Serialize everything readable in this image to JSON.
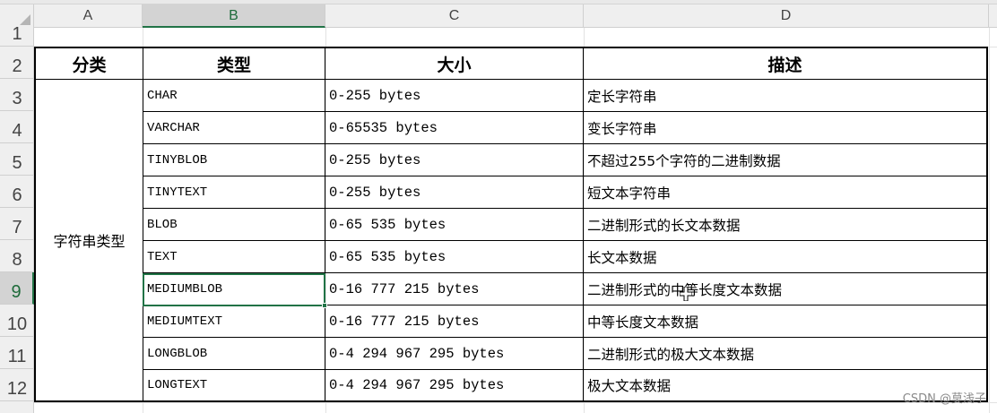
{
  "columns": [
    "A",
    "B",
    "C",
    "D"
  ],
  "rows": [
    "1",
    "2",
    "3",
    "4",
    "5",
    "6",
    "7",
    "8",
    "9",
    "10",
    "11",
    "12"
  ],
  "active_cell": "B9",
  "table": {
    "headers": [
      "分类",
      "类型",
      "大小",
      "描述"
    ],
    "category": "字符串类型",
    "items": [
      {
        "type": "CHAR",
        "size": "0-255 bytes",
        "desc": "定长字符串"
      },
      {
        "type": "VARCHAR",
        "size": "0-65535 bytes",
        "desc": "变长字符串"
      },
      {
        "type": "TINYBLOB",
        "size": "0-255 bytes",
        "desc": "不超过255个字符的二进制数据"
      },
      {
        "type": "TINYTEXT",
        "size": "0-255 bytes",
        "desc": "短文本字符串"
      },
      {
        "type": "BLOB",
        "size": "0-65 535 bytes",
        "desc": "二进制形式的长文本数据"
      },
      {
        "type": "TEXT",
        "size": "0-65 535 bytes",
        "desc": "长文本数据"
      },
      {
        "type": "MEDIUMBLOB",
        "size": "0-16 777 215 bytes",
        "desc": "二进制形式的中等长度文本数据"
      },
      {
        "type": "MEDIUMTEXT",
        "size": "0-16 777 215 bytes",
        "desc": "中等长度文本数据"
      },
      {
        "type": "LONGBLOB",
        "size": "0-4 294 967 295 bytes",
        "desc": "二进制形式的极大文本数据"
      },
      {
        "type": "LONGTEXT",
        "size": "0-4 294 967 295 bytes",
        "desc": "极大文本数据"
      }
    ]
  },
  "watermark": "CSDN @莫浅子",
  "colors": {
    "selection": "#217346",
    "header_bg": "#efefef",
    "border": "#000000"
  }
}
